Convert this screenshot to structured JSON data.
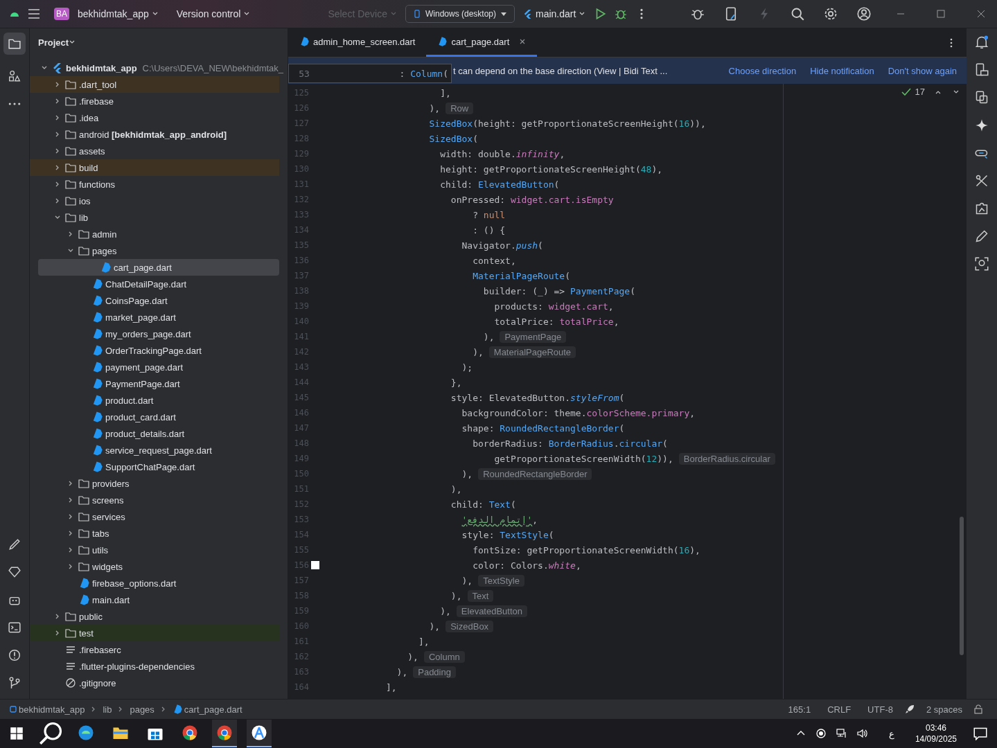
{
  "title_bar": {
    "project_badge": "BA",
    "project": "bekhidmtak_app",
    "version_control": "Version control",
    "select_device": "Select Device",
    "device": "Windows (desktop)",
    "run_config": "main.dart"
  },
  "project_panel": {
    "title": "Project",
    "tree": [
      {
        "label": "bekhidmtak_app",
        "path": "C:\\Users\\DEVA_NEW\\bekhidmtak_",
        "kind": "flutter",
        "expanded": true,
        "selected": false,
        "children": [
          {
            "label": ".dart_tool",
            "kind": "folder",
            "expanded": false,
            "selected": false,
            "color": "#3e3223"
          },
          {
            "label": ".firebase",
            "kind": "folder",
            "expanded": false,
            "selected": false
          },
          {
            "label": ".idea",
            "kind": "folder",
            "expanded": false,
            "selected": false
          },
          {
            "label": "android **[bekhidmtak_app_android]**",
            "kind": "folder",
            "expanded": false,
            "selected": false
          },
          {
            "label": "assets",
            "kind": "folder",
            "expanded": false,
            "selected": false
          },
          {
            "label": "build",
            "kind": "folder",
            "expanded": false,
            "selected": false,
            "color": "#3e3223"
          },
          {
            "label": "functions",
            "kind": "folder",
            "expanded": false,
            "selected": false
          },
          {
            "label": "ios",
            "kind": "folder",
            "expanded": false,
            "selected": false
          },
          {
            "label": "lib",
            "kind": "folder",
            "expanded": true,
            "selected": false,
            "children": [
              {
                "label": "admin",
                "kind": "folder",
                "expanded": false,
                "selected": false
              },
              {
                "label": "pages",
                "kind": "folder",
                "expanded": true,
                "selected": false,
                "children": [
                  {
                    "label": "cart_page.dart",
                    "kind": "dart",
                    "selected": true
                  },
                  {
                    "label": "ChatDetailPage.dart",
                    "kind": "dart",
                    "selected": false
                  },
                  {
                    "label": "CoinsPage.dart",
                    "kind": "dart",
                    "selected": false
                  },
                  {
                    "label": "market_page.dart",
                    "kind": "dart",
                    "selected": false
                  },
                  {
                    "label": "my_orders_page.dart",
                    "kind": "dart",
                    "selected": false
                  },
                  {
                    "label": "OrderTrackingPage.dart",
                    "kind": "dart",
                    "selected": false
                  },
                  {
                    "label": "payment_page.dart",
                    "kind": "dart",
                    "selected": false
                  },
                  {
                    "label": "PaymentPage.dart",
                    "kind": "dart",
                    "selected": false
                  },
                  {
                    "label": "product.dart",
                    "kind": "dart",
                    "selected": false
                  },
                  {
                    "label": "product_card.dart",
                    "kind": "dart",
                    "selected": false
                  },
                  {
                    "label": "product_details.dart",
                    "kind": "dart",
                    "selected": false
                  },
                  {
                    "label": "service_request_page.dart",
                    "kind": "dart",
                    "selected": false
                  },
                  {
                    "label": "SupportChatPage.dart",
                    "kind": "dart",
                    "selected": false
                  }
                ]
              },
              {
                "label": "providers",
                "kind": "folder",
                "expanded": false,
                "selected": false
              },
              {
                "label": "screens",
                "kind": "folder",
                "expanded": false,
                "selected": false
              },
              {
                "label": "services",
                "kind": "folder",
                "expanded": false,
                "selected": false
              },
              {
                "label": "tabs",
                "kind": "folder",
                "expanded": false,
                "selected": false
              },
              {
                "label": "utils",
                "kind": "folder",
                "expanded": false,
                "selected": false
              },
              {
                "label": "widgets",
                "kind": "folder",
                "expanded": false,
                "selected": false
              },
              {
                "label": "firebase_options.dart",
                "kind": "dart",
                "selected": false
              },
              {
                "label": "main.dart",
                "kind": "dart",
                "selected": false
              }
            ]
          },
          {
            "label": "public",
            "kind": "folder",
            "expanded": false,
            "selected": false
          },
          {
            "label": "test",
            "kind": "folder",
            "expanded": false,
            "selected": false,
            "color": "#27331f"
          },
          {
            "label": ".firebaserc",
            "kind": "text",
            "selected": false
          },
          {
            "label": ".flutter-plugins-dependencies",
            "kind": "text",
            "selected": false
          },
          {
            "label": ".gitignore",
            "kind": "ignore",
            "selected": false
          }
        ]
      }
    ]
  },
  "editor": {
    "tabs": [
      {
        "label": "admin_home_screen.dart",
        "selected": false
      },
      {
        "label": "cart_page.dart",
        "selected": true
      }
    ],
    "notification": {
      "text": "t can depend on the base direction (View | Bidi Text ...",
      "actions": [
        "Choose direction",
        "Hide notification",
        "Don't show again"
      ]
    },
    "sticky_line": {
      "number": "53",
      "tokens": [
        {
          "kind": "plain",
          "text": ": "
        },
        {
          "kind": "type",
          "text": "Column"
        },
        {
          "kind": "plain",
          "text": "("
        }
      ]
    },
    "problems_count": "17",
    "lines": [
      {
        "number": "125",
        "tokens": [
          {
            "kind": "plain",
            "text": "                      ],"
          }
        ]
      },
      {
        "number": "126",
        "tokens": [
          {
            "kind": "plain",
            "text": "                    ),"
          },
          {
            "kind": "hint",
            "text": "Row"
          }
        ]
      },
      {
        "number": "127",
        "tokens": [
          {
            "kind": "type",
            "text": "                    SizedBox"
          },
          {
            "kind": "plain",
            "text": "(height: getProportionateScreenHeight("
          },
          {
            "kind": "num",
            "text": "16"
          },
          {
            "kind": "plain",
            "text": ")),"
          }
        ]
      },
      {
        "number": "128",
        "tokens": [
          {
            "kind": "type",
            "text": "                    SizedBox"
          },
          {
            "kind": "plain",
            "text": "("
          }
        ]
      },
      {
        "number": "129",
        "tokens": [
          {
            "kind": "plain",
            "text": "                      width: double."
          },
          {
            "kind": "static",
            "text": "infinity"
          },
          {
            "kind": "plain",
            "text": ","
          }
        ]
      },
      {
        "number": "130",
        "tokens": [
          {
            "kind": "plain",
            "text": "                      height: getProportionateScreenHeight("
          },
          {
            "kind": "num",
            "text": "48"
          },
          {
            "kind": "plain",
            "text": "),"
          }
        ]
      },
      {
        "number": "131",
        "tokens": [
          {
            "kind": "plain",
            "text": "                      child: "
          },
          {
            "kind": "type",
            "text": "ElevatedButton"
          },
          {
            "kind": "plain",
            "text": "("
          }
        ]
      },
      {
        "number": "132",
        "tokens": [
          {
            "kind": "plain",
            "text": "                        onPressed: "
          },
          {
            "kind": "field",
            "text": "widget.cart.isEmpty"
          }
        ]
      },
      {
        "number": "133",
        "tokens": [
          {
            "kind": "plain",
            "text": "                            ? "
          },
          {
            "kind": "kw",
            "text": "null"
          }
        ]
      },
      {
        "number": "134",
        "tokens": [
          {
            "kind": "plain",
            "text": "                            : () {"
          }
        ]
      },
      {
        "number": "135",
        "tokens": [
          {
            "kind": "plain",
            "text": "                          Navigator."
          },
          {
            "kind": "method",
            "text": "push"
          },
          {
            "kind": "plain",
            "text": "("
          }
        ]
      },
      {
        "number": "136",
        "tokens": [
          {
            "kind": "plain",
            "text": "                            context,"
          }
        ]
      },
      {
        "number": "137",
        "tokens": [
          {
            "kind": "type",
            "text": "                            MaterialPageRoute"
          },
          {
            "kind": "plain",
            "text": "("
          }
        ]
      },
      {
        "number": "138",
        "tokens": [
          {
            "kind": "plain",
            "text": "                              builder: (_) => "
          },
          {
            "kind": "type",
            "text": "PaymentPage"
          },
          {
            "kind": "plain",
            "text": "("
          }
        ]
      },
      {
        "number": "139",
        "tokens": [
          {
            "kind": "plain",
            "text": "                                products: "
          },
          {
            "kind": "field",
            "text": "widget.cart"
          },
          {
            "kind": "plain",
            "text": ","
          }
        ]
      },
      {
        "number": "140",
        "tokens": [
          {
            "kind": "plain",
            "text": "                                totalPrice: "
          },
          {
            "kind": "field",
            "text": "totalPrice"
          },
          {
            "kind": "plain",
            "text": ","
          }
        ]
      },
      {
        "number": "141",
        "tokens": [
          {
            "kind": "plain",
            "text": "                              ),"
          },
          {
            "kind": "hint",
            "text": "PaymentPage"
          }
        ]
      },
      {
        "number": "142",
        "tokens": [
          {
            "kind": "plain",
            "text": "                            ),"
          },
          {
            "kind": "hint",
            "text": "MaterialPageRoute"
          }
        ]
      },
      {
        "number": "143",
        "tokens": [
          {
            "kind": "plain",
            "text": "                          );"
          }
        ]
      },
      {
        "number": "144",
        "tokens": [
          {
            "kind": "plain",
            "text": "                        },"
          }
        ]
      },
      {
        "number": "145",
        "tokens": [
          {
            "kind": "plain",
            "text": "                        style: ElevatedButton."
          },
          {
            "kind": "method",
            "text": "styleFrom"
          },
          {
            "kind": "plain",
            "text": "("
          }
        ]
      },
      {
        "number": "146",
        "tokens": [
          {
            "kind": "plain",
            "text": "                          backgroundColor: theme."
          },
          {
            "kind": "field",
            "text": "colorScheme.primary"
          },
          {
            "kind": "plain",
            "text": ","
          }
        ]
      },
      {
        "number": "147",
        "tokens": [
          {
            "kind": "plain",
            "text": "                          shape: "
          },
          {
            "kind": "type",
            "text": "RoundedRectangleBorder"
          },
          {
            "kind": "plain",
            "text": "("
          }
        ]
      },
      {
        "number": "148",
        "tokens": [
          {
            "kind": "plain",
            "text": "                            borderRadius: "
          },
          {
            "kind": "type",
            "text": "BorderRadius"
          },
          {
            "kind": "plain",
            "text": "."
          },
          {
            "kind": "type",
            "text": "circular"
          },
          {
            "kind": "plain",
            "text": "("
          }
        ]
      },
      {
        "number": "149",
        "tokens": [
          {
            "kind": "plain",
            "text": "                                getProportionateScreenWidth("
          },
          {
            "kind": "num",
            "text": "12"
          },
          {
            "kind": "plain",
            "text": ")),"
          },
          {
            "kind": "hint",
            "text": "BorderRadius.circular"
          }
        ]
      },
      {
        "number": "150",
        "tokens": [
          {
            "kind": "plain",
            "text": "                          ),"
          },
          {
            "kind": "hint",
            "text": "RoundedRectangleBorder"
          }
        ]
      },
      {
        "number": "151",
        "tokens": [
          {
            "kind": "plain",
            "text": "                        ),"
          }
        ]
      },
      {
        "number": "152",
        "tokens": [
          {
            "kind": "plain",
            "text": "                        child: "
          },
          {
            "kind": "type",
            "text": "Text"
          },
          {
            "kind": "plain",
            "text": "("
          }
        ]
      },
      {
        "number": "153",
        "tokens": [
          {
            "kind": "str",
            "text": "                          'إتمام الدفع'"
          },
          {
            "kind": "plain",
            "text": ","
          }
        ]
      },
      {
        "number": "154",
        "tokens": [
          {
            "kind": "plain",
            "text": "                          style: "
          },
          {
            "kind": "type",
            "text": "TextStyle"
          },
          {
            "kind": "plain",
            "text": "("
          }
        ]
      },
      {
        "number": "155",
        "tokens": [
          {
            "kind": "plain",
            "text": "                            fontSize: getProportionateScreenWidth("
          },
          {
            "kind": "num",
            "text": "16"
          },
          {
            "kind": "plain",
            "text": "),"
          }
        ]
      },
      {
        "number": "156",
        "color": "#ffffff",
        "tokens": [
          {
            "kind": "plain",
            "text": "                            color: Colors."
          },
          {
            "kind": "static",
            "text": "white"
          },
          {
            "kind": "plain",
            "text": ","
          }
        ]
      },
      {
        "number": "157",
        "tokens": [
          {
            "kind": "plain",
            "text": "                          ),"
          },
          {
            "kind": "hint",
            "text": "TextStyle"
          }
        ]
      },
      {
        "number": "158",
        "tokens": [
          {
            "kind": "plain",
            "text": "                        ),"
          },
          {
            "kind": "hint",
            "text": "Text"
          }
        ]
      },
      {
        "number": "159",
        "tokens": [
          {
            "kind": "plain",
            "text": "                      ),"
          },
          {
            "kind": "hint",
            "text": "ElevatedButton"
          }
        ]
      },
      {
        "number": "160",
        "tokens": [
          {
            "kind": "plain",
            "text": "                    ),"
          },
          {
            "kind": "hint",
            "text": "SizedBox"
          }
        ]
      },
      {
        "number": "161",
        "tokens": [
          {
            "kind": "plain",
            "text": "                  ],"
          }
        ]
      },
      {
        "number": "162",
        "tokens": [
          {
            "kind": "plain",
            "text": "                ),"
          },
          {
            "kind": "hint",
            "text": "Column"
          }
        ]
      },
      {
        "number": "163",
        "tokens": [
          {
            "kind": "plain",
            "text": "              ),"
          },
          {
            "kind": "hint",
            "text": "Padding"
          }
        ]
      },
      {
        "number": "164",
        "tokens": [
          {
            "kind": "plain",
            "text": "            ],"
          }
        ]
      }
    ]
  },
  "status_bar": {
    "breadcrumbs": [
      {
        "label": "bekhidmtak_app",
        "kind": "module"
      },
      {
        "label": "lib",
        "kind": "folder"
      },
      {
        "label": "pages",
        "kind": "folder"
      },
      {
        "label": "cart_page.dart",
        "kind": "dart"
      }
    ],
    "position": "165:1",
    "line_separator": "CRLF",
    "encoding": "UTF-8",
    "indent": "2 spaces"
  },
  "taskbar": {
    "apps": [
      {
        "kind": "edge",
        "active": false
      },
      {
        "kind": "explorer",
        "active": false
      },
      {
        "kind": "store",
        "active": false
      },
      {
        "kind": "chrome",
        "active": false
      },
      {
        "kind": "chrome-canary",
        "active": true
      },
      {
        "kind": "studio",
        "active": true
      }
    ],
    "keyboard": "ع",
    "time": "03:46",
    "date": "14/09/2025"
  }
}
